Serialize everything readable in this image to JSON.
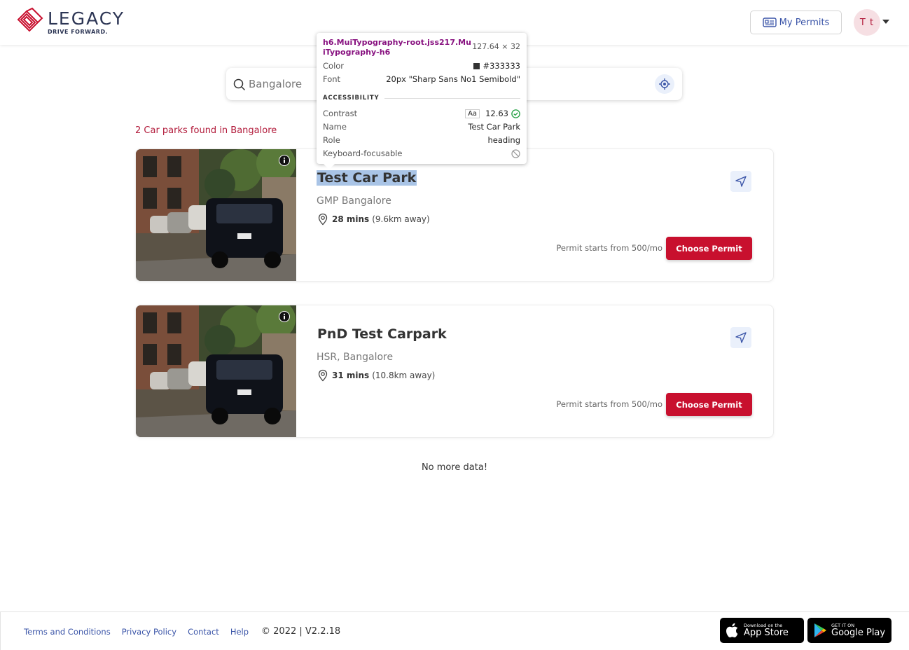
{
  "header": {
    "logo_word": "LEGACY",
    "logo_tagline": "DRIVE FORWARD.",
    "my_permits_label": "My Permits",
    "avatar_initials": "T t"
  },
  "search": {
    "value": "Bangalore",
    "search_icon": "search-icon",
    "locate_icon": "crosshair-icon"
  },
  "results": {
    "count_text": "2 Car parks found in Bangalore",
    "cards": [
      {
        "title": "Test Car Park",
        "area": "GMP Bangalore",
        "time": "28 mins",
        "distance": "(9.6km away)",
        "price": "Permit starts from 500/mo",
        "button": "Choose Permit"
      },
      {
        "title": "PnD Test Carpark",
        "area": "HSR, Bangalore",
        "time": "31 mins",
        "distance": "(10.8km away)",
        "price": "Permit starts from 500/mo",
        "button": "Choose Permit"
      }
    ],
    "end_text": "No more data!"
  },
  "tooltip": {
    "selector": "h6.MuiTypography-root.jss217.MuiTypography-h6",
    "size": "127.64 × 32",
    "color_label": "Color",
    "color_value": "#333333",
    "font_label": "Font",
    "font_value": "20px \"Sharp Sans No1 Semibold\"",
    "section": "ACCESSIBILITY",
    "contrast_label": "Contrast",
    "contrast_aa": "Aa",
    "contrast_value": "12.63",
    "name_label": "Name",
    "name_value": "Test Car Park",
    "role_label": "Role",
    "role_value": "heading",
    "keyboard_label": "Keyboard-focusable"
  },
  "footer": {
    "links": [
      "Terms and Conditions",
      "Privacy Policy",
      "Contact",
      "Help"
    ],
    "copyright": "© 2022 | V2.2.18",
    "app_store_small": "Download on the",
    "app_store_big": "App Store",
    "play_small": "GET IT ON",
    "play_big": "Google Play"
  },
  "colors": {
    "brand": "#c8102e",
    "link": "#3b55a8",
    "text": "#333333"
  }
}
